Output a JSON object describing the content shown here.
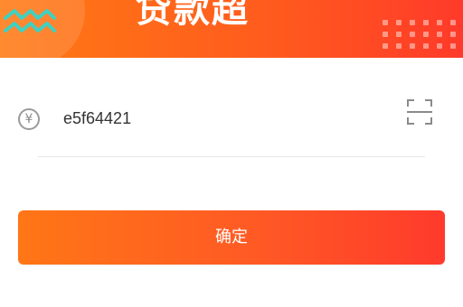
{
  "banner": {
    "title": "贷款超"
  },
  "amount": {
    "currency_symbol": "¥",
    "value": "e5f64421"
  },
  "actions": {
    "confirm_label": "确定"
  },
  "icons": {
    "currency": "yen-circle-icon",
    "scan": "scan-icon",
    "decoration": "zigzag-icon"
  },
  "colors": {
    "accent_start": "#ff7616",
    "accent_end": "#ff3a2c",
    "decoration": "#3fd1c2"
  }
}
